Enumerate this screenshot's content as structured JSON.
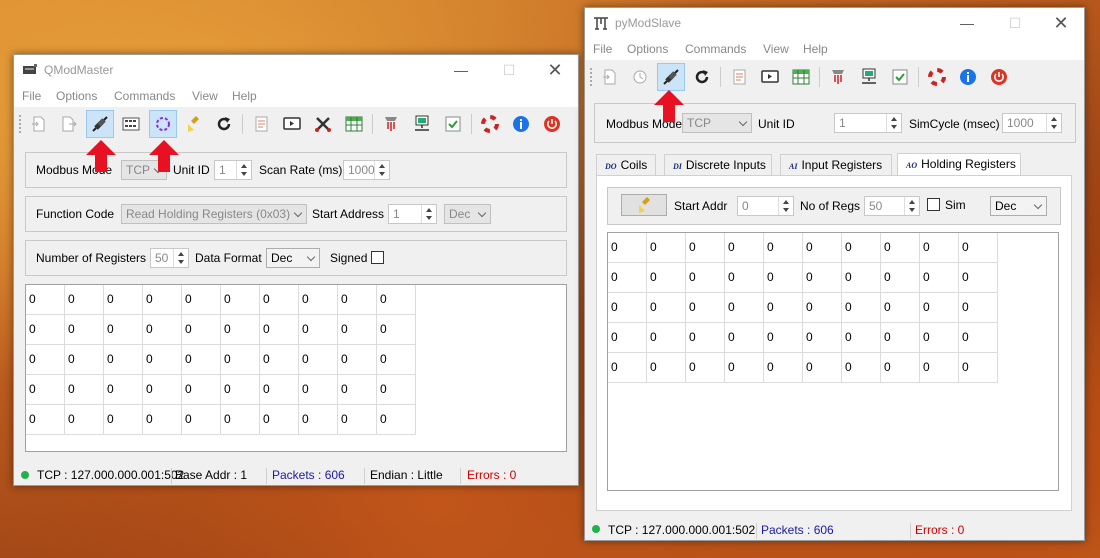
{
  "qmodmaster": {
    "title": "QModMaster",
    "menu": [
      "File",
      "Options",
      "Commands",
      "View",
      "Help"
    ],
    "toolbar_icons": [
      "new-session-icon",
      "load-session-icon",
      "connect-icon",
      "read-write-icon",
      "scan-icon",
      "clear-icon",
      "refresh-icon",
      "log-icon",
      "bus-monitor-icon",
      "tools-icon",
      "table-icon",
      "settings-icon",
      "network-icon",
      "checklist-icon",
      "help-lifebuoy-icon",
      "info-icon",
      "exit-icon"
    ],
    "modbus_mode_label": "Modbus Mode",
    "modbus_mode_value": "TCP",
    "unit_id_label": "Unit ID",
    "unit_id_value": "1",
    "scan_rate_label": "Scan Rate (ms)",
    "scan_rate_value": "1000",
    "function_code_label": "Function Code",
    "function_code_value": "Read Holding Registers (0x03)",
    "start_address_label": "Start Address",
    "start_address_value": "1",
    "start_address_format": "Dec",
    "num_registers_label": "Number of Registers",
    "num_registers_value": "50",
    "data_format_label": "Data Format",
    "data_format_value": "Dec",
    "signed_label": "Signed",
    "table_rows": [
      [
        "0",
        "0",
        "0",
        "0",
        "0",
        "0",
        "0",
        "0",
        "0",
        "0"
      ],
      [
        "0",
        "0",
        "0",
        "0",
        "0",
        "0",
        "0",
        "0",
        "0",
        "0"
      ],
      [
        "0",
        "0",
        "0",
        "0",
        "0",
        "0",
        "0",
        "0",
        "0",
        "0"
      ],
      [
        "0",
        "0",
        "0",
        "0",
        "0",
        "0",
        "0",
        "0",
        "0",
        "0"
      ],
      [
        "0",
        "0",
        "0",
        "0",
        "0",
        "0",
        "0",
        "0",
        "0",
        "0"
      ]
    ],
    "status": {
      "connection": "TCP : 127.000.000.001:502",
      "base_addr": "Base Addr : 1",
      "packets": "Packets : 606",
      "endian": "Endian : Little",
      "errors": "Errors : 0"
    }
  },
  "pymodslave": {
    "title": "pyModSlave",
    "menu": [
      "File",
      "Options",
      "Commands",
      "View",
      "Help"
    ],
    "toolbar_icons": [
      "new-icon",
      "open-icon",
      "connect-icon",
      "refresh-icon",
      "log-icon",
      "monitor-icon",
      "table-icon",
      "settings-icon",
      "network-icon",
      "checklist-icon",
      "help-lifebuoy-icon",
      "info-icon",
      "exit-icon"
    ],
    "modbus_mode_label": "Modbus Mode",
    "modbus_mode_value": "TCP",
    "unit_id_label": "Unit ID",
    "unit_id_value": "1",
    "simcycle_label": "SimCycle (msec)",
    "simcycle_value": "1000",
    "tabs": [
      {
        "icon": "DO",
        "label": "Coils"
      },
      {
        "icon": "DI",
        "label": "Discrete Inputs"
      },
      {
        "icon": "AI",
        "label": "Input Registers"
      },
      {
        "icon": "AO",
        "label": "Holding Registers"
      }
    ],
    "start_addr_label": "Start Addr",
    "start_addr_value": "0",
    "no_of_regs_label": "No of Regs",
    "no_of_regs_value": "50",
    "sim_label": "Sim",
    "format_value": "Dec",
    "table_rows": [
      [
        "0",
        "0",
        "0",
        "0",
        "0",
        "0",
        "0",
        "0",
        "0",
        "0"
      ],
      [
        "0",
        "0",
        "0",
        "0",
        "0",
        "0",
        "0",
        "0",
        "0",
        "0"
      ],
      [
        "0",
        "0",
        "0",
        "0",
        "0",
        "0",
        "0",
        "0",
        "0",
        "0"
      ],
      [
        "0",
        "0",
        "0",
        "0",
        "0",
        "0",
        "0",
        "0",
        "0",
        "0"
      ],
      [
        "0",
        "0",
        "0",
        "0",
        "0",
        "0",
        "0",
        "0",
        "0",
        "0"
      ]
    ],
    "status": {
      "connection": "TCP : 127.000.000.001:502",
      "packets": "Packets : 606",
      "errors": "Errors : 0"
    }
  },
  "colors": {
    "accent_blue": "#1a1aa6",
    "error_red": "#cc0000",
    "status_green": "#22b14c",
    "highlight_arrow": "#e81123"
  }
}
